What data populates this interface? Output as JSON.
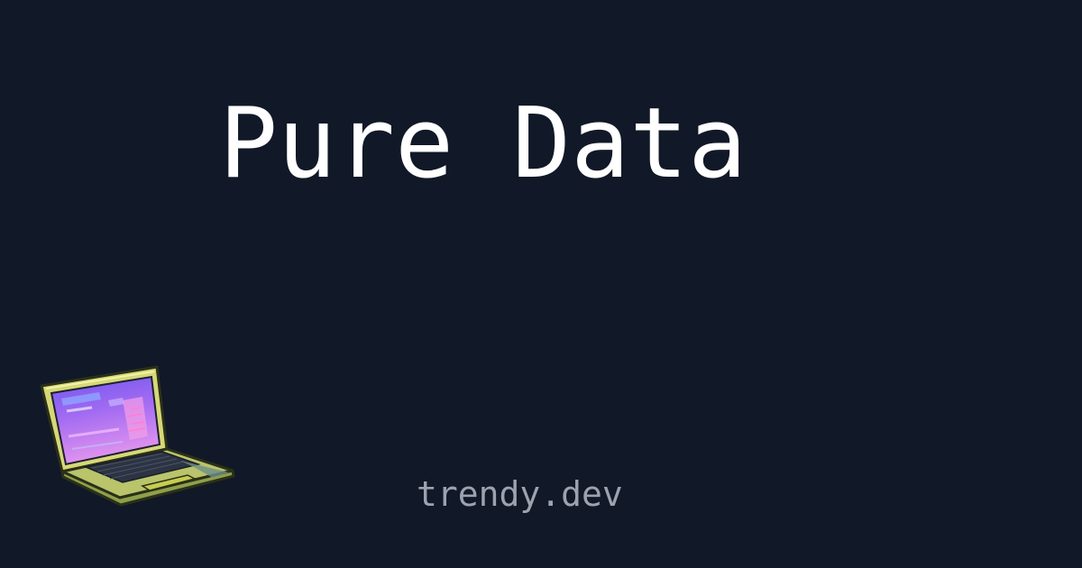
{
  "card": {
    "title": "Pure Data",
    "site": "trendy.dev",
    "illustration": "laptop-icon"
  },
  "colors": {
    "background": "#111827",
    "title": "#ffffff",
    "site": "#9ca3af",
    "laptop_body": "#d6d877",
    "laptop_outline": "#2b3019",
    "screen_top": "#7c5cf0",
    "screen_bottom": "#e08ff0",
    "keyboard": "#2c3342",
    "trackpad": "#c8cc4f"
  }
}
